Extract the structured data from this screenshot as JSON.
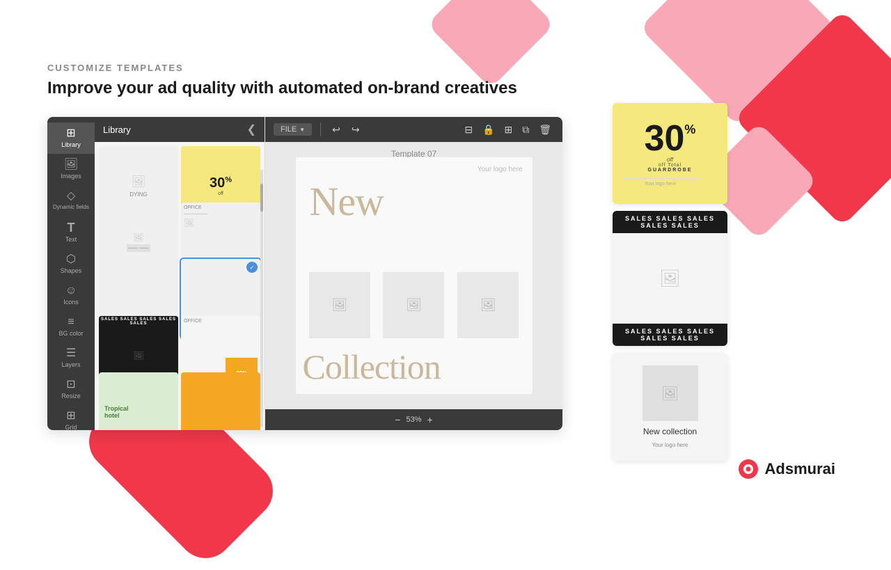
{
  "page": {
    "background": "#ffffff"
  },
  "header": {
    "label": "CUSTOMIZE TEMPLATES",
    "headline": "Improve your ad quality with automated on-brand creatives"
  },
  "sidebar": {
    "items": [
      {
        "id": "library",
        "label": "Library",
        "icon": "⊞",
        "active": true
      },
      {
        "id": "images",
        "label": "Images",
        "icon": "🖼"
      },
      {
        "id": "dynamic",
        "label": "Dynamic fields",
        "icon": "◇"
      },
      {
        "id": "text",
        "label": "Text",
        "icon": "T"
      },
      {
        "id": "shapes",
        "label": "Shapes",
        "icon": "⬟"
      },
      {
        "id": "icons",
        "label": "Icons",
        "icon": "☺"
      },
      {
        "id": "bgcolor",
        "label": "BG color",
        "icon": "≡"
      },
      {
        "id": "layers",
        "label": "Layers",
        "icon": "☰"
      },
      {
        "id": "resize",
        "label": "Resize",
        "icon": "⊡"
      },
      {
        "id": "grid",
        "label": "Grid",
        "icon": "⊞"
      }
    ]
  },
  "panel": {
    "title": "Library",
    "close_icon": "❮"
  },
  "toolbar": {
    "file_label": "FILE",
    "undo_icon": "↩",
    "redo_icon": "↪"
  },
  "canvas": {
    "template_name": "Template 07",
    "logo_placeholder": "Your logo here",
    "new_text": "New",
    "collection_text": "Collection",
    "zoom_level": "53%"
  },
  "previews": {
    "card1": {
      "discount": "30",
      "superscript": "%",
      "off_label": "off",
      "subtitle": "off Total",
      "subtitle2": "GUARDROBE",
      "logo": "Your logo here"
    },
    "card2": {
      "ticker": "SALES SALES SALES SALES SALES",
      "ticker_bottom": "SALES SALES SALES SALES SALES"
    },
    "card3": {
      "title": "New collection",
      "logo": "Your logo here"
    }
  },
  "brand": {
    "name": "Adsmurai"
  }
}
